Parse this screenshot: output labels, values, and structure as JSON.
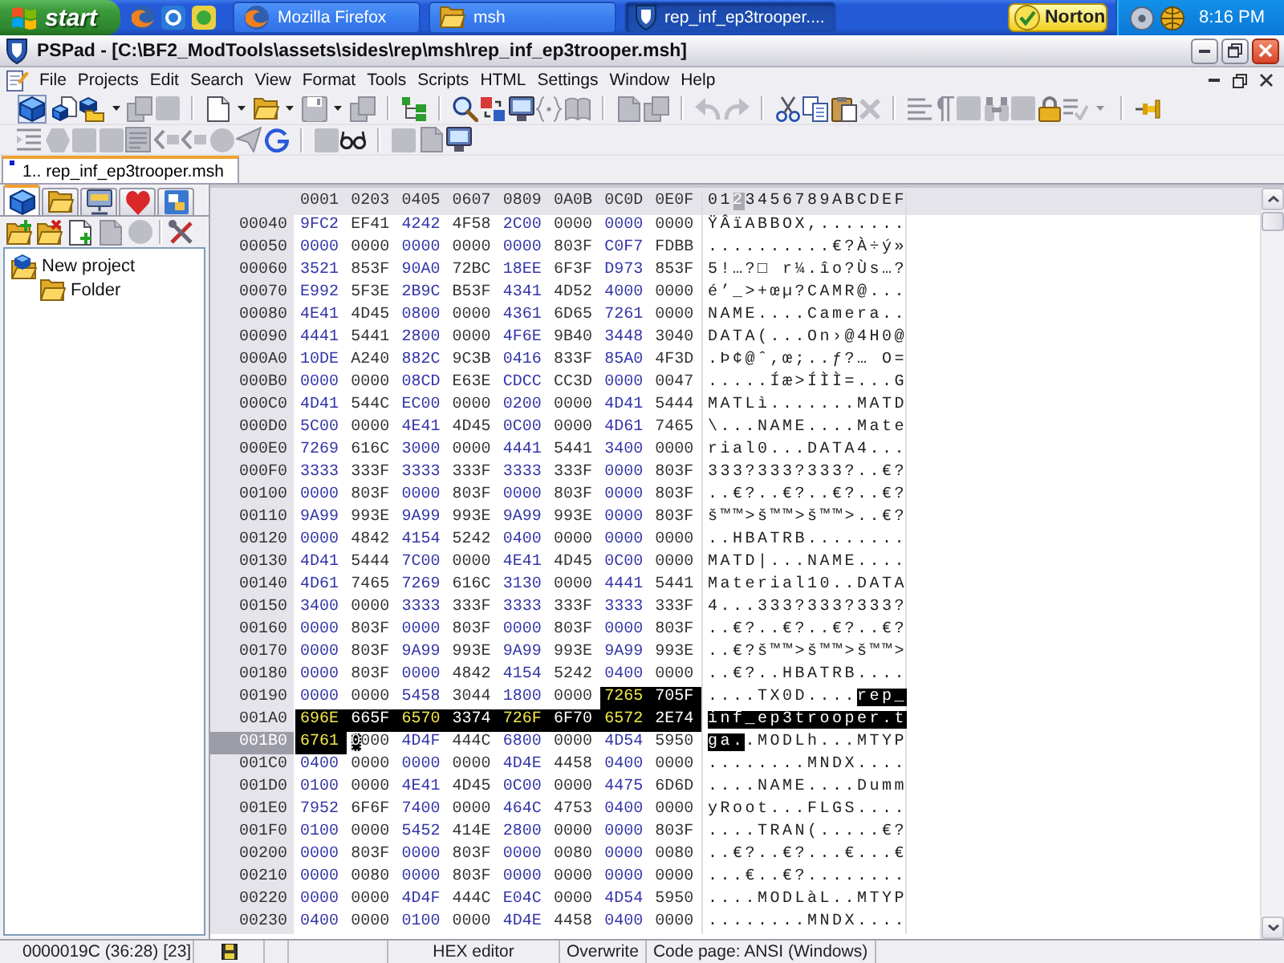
{
  "taskbar": {
    "start": "start",
    "tasks": [
      {
        "label": "Mozilla Firefox",
        "kind": "browser",
        "selected": false
      },
      {
        "label": "msh",
        "kind": "folder",
        "selected": false
      },
      {
        "label": "rep_inf_ep3trooper....",
        "kind": "editor",
        "selected": true
      }
    ],
    "norton": "Norton",
    "clock": "8:16 PM"
  },
  "window": {
    "title": "PSPad - [C:\\BF2_ModTools\\assets\\sides\\rep\\msh\\rep_inf_ep3trooper.msh]"
  },
  "menu": [
    "File",
    "Projects",
    "Edit",
    "Search",
    "View",
    "Format",
    "Tools",
    "Scripts",
    "HTML",
    "Settings",
    "Window",
    "Help"
  ],
  "toolbars": [
    [
      [
        {
          "kind": "cube",
          "disabled": false,
          "pressed": true
        },
        {
          "kind": "cubes",
          "disabled": false,
          "pressed": false
        },
        {
          "kind": "cube-folder",
          "disabled": false,
          "pressed": false
        },
        {
          "kind": "caret",
          "disabled": false,
          "pressed": false
        },
        {
          "kind": "pages",
          "disabled": true,
          "pressed": false
        },
        {
          "kind": "square",
          "disabled": true,
          "pressed": false
        }
      ],
      [
        {
          "kind": "page",
          "disabled": false,
          "pressed": false
        },
        {
          "kind": "caret",
          "disabled": false,
          "pressed": false
        },
        {
          "kind": "folder",
          "disabled": false,
          "pressed": false
        },
        {
          "kind": "caret",
          "disabled": false,
          "pressed": false
        },
        {
          "kind": "floppy",
          "disabled": true,
          "pressed": false
        },
        {
          "kind": "caret",
          "disabled": false,
          "pressed": false
        },
        {
          "kind": "pages",
          "disabled": true,
          "pressed": false
        }
      ],
      [
        {
          "kind": "tree",
          "disabled": false,
          "pressed": false
        }
      ],
      [
        {
          "kind": "search",
          "disabled": false,
          "pressed": false
        },
        {
          "kind": "replace",
          "disabled": false,
          "pressed": false
        },
        {
          "kind": "monitor",
          "disabled": false,
          "pressed": false
        },
        {
          "kind": "braces",
          "disabled": true,
          "pressed": false
        },
        {
          "kind": "book",
          "disabled": true,
          "pressed": false
        }
      ],
      [
        {
          "kind": "page",
          "disabled": true,
          "pressed": false
        },
        {
          "kind": "pages",
          "disabled": true,
          "pressed": false
        }
      ],
      [
        {
          "kind": "undo",
          "disabled": true,
          "pressed": false
        },
        {
          "kind": "redo",
          "disabled": true,
          "pressed": false
        }
      ],
      [
        {
          "kind": "scissors",
          "disabled": false,
          "pressed": false
        },
        {
          "kind": "copy",
          "disabled": false,
          "pressed": false
        },
        {
          "kind": "paste",
          "disabled": false,
          "pressed": false
        },
        {
          "kind": "delete",
          "disabled": true,
          "pressed": false
        }
      ],
      [
        {
          "kind": "lines",
          "disabled": true,
          "pressed": false
        },
        {
          "kind": "pilcrow",
          "disabled": true,
          "pressed": false
        },
        {
          "kind": "square",
          "disabled": true,
          "pressed": false
        },
        {
          "kind": "binoculars",
          "disabled": true,
          "pressed": false
        },
        {
          "kind": "square",
          "disabled": true,
          "pressed": false
        },
        {
          "kind": "lock",
          "disabled": false,
          "pressed": false
        },
        {
          "kind": "spell",
          "disabled": true,
          "pressed": false
        },
        {
          "kind": "caret",
          "disabled": true,
          "pressed": false
        }
      ],
      [
        {
          "kind": "pin",
          "disabled": false,
          "pressed": false
        }
      ]
    ],
    [
      [
        {
          "kind": "indent",
          "disabled": true,
          "pressed": false
        },
        {
          "kind": "hexagon",
          "disabled": true,
          "pressed": false
        },
        {
          "kind": "square",
          "disabled": true,
          "pressed": false
        },
        {
          "kind": "square",
          "disabled": true,
          "pressed": false
        },
        {
          "kind": "text-doc",
          "disabled": true,
          "pressed": false
        },
        {
          "kind": "tag",
          "disabled": true,
          "pressed": false
        },
        {
          "kind": "tag",
          "disabled": true,
          "pressed": false
        },
        {
          "kind": "circle",
          "disabled": true,
          "pressed": false
        },
        {
          "kind": "plane",
          "disabled": true,
          "pressed": false
        },
        {
          "kind": "g",
          "disabled": false,
          "pressed": false
        }
      ],
      [
        {
          "kind": "square",
          "disabled": true,
          "pressed": false
        },
        {
          "kind": "glasses",
          "disabled": false,
          "pressed": false
        }
      ],
      [
        {
          "kind": "square",
          "disabled": true,
          "pressed": false
        },
        {
          "kind": "page",
          "disabled": true,
          "pressed": false
        },
        {
          "kind": "monitor",
          "disabled": false,
          "pressed": false
        }
      ]
    ]
  ],
  "editor_tabs": [
    {
      "label": "1.. rep_inf_ep3trooper.msh",
      "selected": true,
      "modified": true
    }
  ],
  "project_panel": {
    "tabs": [
      {
        "kind": "project",
        "selected": true
      },
      {
        "kind": "folder",
        "selected": false
      },
      {
        "kind": "ftp",
        "selected": false
      },
      {
        "kind": "favorites",
        "selected": false
      },
      {
        "kind": "clips",
        "selected": false
      }
    ],
    "tools": [
      [
        {
          "kind": "folder-add",
          "disabled": false
        },
        {
          "kind": "folder-remove",
          "disabled": false
        },
        {
          "kind": "page-add",
          "disabled": false
        },
        {
          "kind": "page-remove",
          "disabled": true
        },
        {
          "kind": "circle",
          "disabled": true
        }
      ],
      [
        {
          "kind": "tools",
          "disabled": false
        }
      ]
    ],
    "tree": [
      {
        "label": "New project",
        "kind": "project",
        "children": [
          {
            "label": "Folder",
            "kind": "folder"
          }
        ]
      }
    ]
  },
  "hex_view": {
    "columns": [
      "0001",
      "0203",
      "0405",
      "0607",
      "0809",
      "0A0B",
      "0C0D",
      "0E0F"
    ],
    "ascii_header": [
      {
        "text": "01",
        "selected": false
      },
      {
        "text": "2",
        "selected": true
      },
      {
        "text": "3456789ABCDEF",
        "selected": false
      }
    ],
    "rows": [
      {
        "address": "00040",
        "selected": false,
        "hex": [
          "9FC2",
          "EF41",
          "4242",
          "4F58",
          "2C00",
          "0000",
          "0000",
          "0000"
        ],
        "ascii": [
          {
            "text": "ŸÂïABBOX,.......",
            "selected": false,
            "cursor": false
          }
        ]
      },
      {
        "address": "00050",
        "selected": false,
        "hex": [
          "0000",
          "0000",
          "0000",
          "0000",
          "0000",
          "803F",
          "C0F7",
          "FDBB"
        ],
        "ascii": [
          {
            "text": "..........€?À÷ý»",
            "selected": false,
            "cursor": false
          }
        ]
      },
      {
        "address": "00060",
        "selected": false,
        "hex": [
          "3521",
          "853F",
          "90A0",
          "72BC",
          "18EE",
          "6F3F",
          "D973",
          "853F"
        ],
        "ascii": [
          {
            "text": "5!…?□ r¼.îo?Ùs…?",
            "selected": false,
            "cursor": false
          }
        ]
      },
      {
        "address": "00070",
        "selected": false,
        "hex": [
          "E992",
          "5F3E",
          "2B9C",
          "B53F",
          "4341",
          "4D52",
          "4000",
          "0000"
        ],
        "ascii": [
          {
            "text": "é’_>+œµ?CAMR@...",
            "selected": false,
            "cursor": false
          }
        ]
      },
      {
        "address": "00080",
        "selected": false,
        "hex": [
          "4E41",
          "4D45",
          "0800",
          "0000",
          "4361",
          "6D65",
          "7261",
          "0000"
        ],
        "ascii": [
          {
            "text": "NAME....Camera..",
            "selected": false,
            "cursor": false
          }
        ]
      },
      {
        "address": "00090",
        "selected": false,
        "hex": [
          "4441",
          "5441",
          "2800",
          "0000",
          "4F6E",
          "9B40",
          "3448",
          "3040"
        ],
        "ascii": [
          {
            "text": "DATA(...On›@4H0@",
            "selected": false,
            "cursor": false
          }
        ]
      },
      {
        "address": "000A0",
        "selected": false,
        "hex": [
          "10DE",
          "A240",
          "882C",
          "9C3B",
          "0416",
          "833F",
          "85A0",
          "4F3D"
        ],
        "ascii": [
          {
            "text": ".Þ¢@ˆ,œ;..ƒ?… O=",
            "selected": false,
            "cursor": false
          }
        ]
      },
      {
        "address": "000B0",
        "selected": false,
        "hex": [
          "0000",
          "0000",
          "08CD",
          "E63E",
          "CDCC",
          "CC3D",
          "0000",
          "0047"
        ],
        "ascii": [
          {
            "text": ".....Íæ>ÍÌÌ=...G",
            "selected": false,
            "cursor": false
          }
        ]
      },
      {
        "address": "000C0",
        "selected": false,
        "hex": [
          "4D41",
          "544C",
          "EC00",
          "0000",
          "0200",
          "0000",
          "4D41",
          "5444"
        ],
        "ascii": [
          {
            "text": "MATLì.......MATD",
            "selected": false,
            "cursor": false
          }
        ]
      },
      {
        "address": "000D0",
        "selected": false,
        "hex": [
          "5C00",
          "0000",
          "4E41",
          "4D45",
          "0C00",
          "0000",
          "4D61",
          "7465"
        ],
        "ascii": [
          {
            "text": "\\...NAME....Mate",
            "selected": false,
            "cursor": false
          }
        ]
      },
      {
        "address": "000E0",
        "selected": false,
        "hex": [
          "7269",
          "616C",
          "3000",
          "0000",
          "4441",
          "5441",
          "3400",
          "0000"
        ],
        "ascii": [
          {
            "text": "rial0...DATA4...",
            "selected": false,
            "cursor": false
          }
        ]
      },
      {
        "address": "000F0",
        "selected": false,
        "hex": [
          "3333",
          "333F",
          "3333",
          "333F",
          "3333",
          "333F",
          "0000",
          "803F"
        ],
        "ascii": [
          {
            "text": "333?333?333?..€?",
            "selected": false,
            "cursor": false
          }
        ]
      },
      {
        "address": "00100",
        "selected": false,
        "hex": [
          "0000",
          "803F",
          "0000",
          "803F",
          "0000",
          "803F",
          "0000",
          "803F"
        ],
        "ascii": [
          {
            "text": "..€?..€?..€?..€?",
            "selected": false,
            "cursor": false
          }
        ]
      },
      {
        "address": "00110",
        "selected": false,
        "hex": [
          "9A99",
          "993E",
          "9A99",
          "993E",
          "9A99",
          "993E",
          "0000",
          "803F"
        ],
        "ascii": [
          {
            "text": "š™™>š™™>š™™>..€?",
            "selected": false,
            "cursor": false
          }
        ]
      },
      {
        "address": "00120",
        "selected": false,
        "hex": [
          "0000",
          "4842",
          "4154",
          "5242",
          "0400",
          "0000",
          "0000",
          "0000"
        ],
        "ascii": [
          {
            "text": "..HBATRB........",
            "selected": false,
            "cursor": false
          }
        ]
      },
      {
        "address": "00130",
        "selected": false,
        "hex": [
          "4D41",
          "5444",
          "7C00",
          "0000",
          "4E41",
          "4D45",
          "0C00",
          "0000"
        ],
        "ascii": [
          {
            "text": "MATD|...NAME....",
            "selected": false,
            "cursor": false
          }
        ]
      },
      {
        "address": "00140",
        "selected": false,
        "hex": [
          "4D61",
          "7465",
          "7269",
          "616C",
          "3130",
          "0000",
          "4441",
          "5441"
        ],
        "ascii": [
          {
            "text": "Material10..DATA",
            "selected": false,
            "cursor": false
          }
        ]
      },
      {
        "address": "00150",
        "selected": false,
        "hex": [
          "3400",
          "0000",
          "3333",
          "333F",
          "3333",
          "333F",
          "3333",
          "333F"
        ],
        "ascii": [
          {
            "text": "4...333?333?333?",
            "selected": false,
            "cursor": false
          }
        ]
      },
      {
        "address": "00160",
        "selected": false,
        "hex": [
          "0000",
          "803F",
          "0000",
          "803F",
          "0000",
          "803F",
          "0000",
          "803F"
        ],
        "ascii": [
          {
            "text": "..€?..€?..€?..€?",
            "selected": false,
            "cursor": false
          }
        ]
      },
      {
        "address": "00170",
        "selected": false,
        "hex": [
          "0000",
          "803F",
          "9A99",
          "993E",
          "9A99",
          "993E",
          "9A99",
          "993E"
        ],
        "ascii": [
          {
            "text": "..€?š™™>š™™>š™™>",
            "selected": false,
            "cursor": false
          }
        ]
      },
      {
        "address": "00180",
        "selected": false,
        "hex": [
          "0000",
          "803F",
          "0000",
          "4842",
          "4154",
          "5242",
          "0400",
          "0000"
        ],
        "ascii": [
          {
            "text": "..€?..HBATRB....",
            "selected": false,
            "cursor": false
          }
        ]
      },
      {
        "address": "00190",
        "selected": false,
        "hex": [
          "0000",
          "0000",
          "5458",
          "3044",
          "1800",
          "0000",
          "7265",
          "705F"
        ],
        "ascii": [
          {
            "text": "....TX0D....",
            "selected": false,
            "cursor": false
          },
          {
            "text": "rep_",
            "selected": true,
            "cursor": false
          }
        ]
      },
      {
        "address": "001A0",
        "selected": false,
        "hex": [
          "696E",
          "665F",
          "6570",
          "3374",
          "726F",
          "6F70",
          "6572",
          "2E74"
        ],
        "ascii": [
          {
            "text": "inf_ep3trooper.t",
            "selected": true,
            "cursor": false
          }
        ]
      },
      {
        "address": "001B0",
        "selected": true,
        "hex": [
          "6761",
          "0000",
          "4D4F",
          "444C",
          "6800",
          "0000",
          "4D54",
          "5950"
        ],
        "ascii": [
          {
            "text": "ga",
            "selected": true,
            "cursor": false
          },
          {
            "text": ".",
            "selected": false,
            "cursor": true
          },
          {
            "text": ".MODLh...MTYP",
            "selected": false,
            "cursor": false
          }
        ]
      },
      {
        "address": "001C0",
        "selected": false,
        "hex": [
          "0400",
          "0000",
          "0000",
          "0000",
          "4D4E",
          "4458",
          "0400",
          "0000"
        ],
        "ascii": [
          {
            "text": "........MNDX....",
            "selected": false,
            "cursor": false
          }
        ]
      },
      {
        "address": "001D0",
        "selected": false,
        "hex": [
          "0100",
          "0000",
          "4E41",
          "4D45",
          "0C00",
          "0000",
          "4475",
          "6D6D"
        ],
        "ascii": [
          {
            "text": "....NAME....Dumm",
            "selected": false,
            "cursor": false
          }
        ]
      },
      {
        "address": "001E0",
        "selected": false,
        "hex": [
          "7952",
          "6F6F",
          "7400",
          "0000",
          "464C",
          "4753",
          "0400",
          "0000"
        ],
        "ascii": [
          {
            "text": "yRoot...FLGS....",
            "selected": false,
            "cursor": false
          }
        ]
      },
      {
        "address": "001F0",
        "selected": false,
        "hex": [
          "0100",
          "0000",
          "5452",
          "414E",
          "2800",
          "0000",
          "0000",
          "803F"
        ],
        "ascii": [
          {
            "text": "....TRAN(.....€?",
            "selected": false,
            "cursor": false
          }
        ]
      },
      {
        "address": "00200",
        "selected": false,
        "hex": [
          "0000",
          "803F",
          "0000",
          "803F",
          "0000",
          "0080",
          "0000",
          "0080"
        ],
        "ascii": [
          {
            "text": "..€?..€?...€...€",
            "selected": false,
            "cursor": false
          }
        ]
      },
      {
        "address": "00210",
        "selected": false,
        "hex": [
          "0000",
          "0080",
          "0000",
          "803F",
          "0000",
          "0000",
          "0000",
          "0000"
        ],
        "ascii": [
          {
            "text": "...€..€?........",
            "selected": false,
            "cursor": false
          }
        ]
      },
      {
        "address": "00220",
        "selected": false,
        "hex": [
          "0000",
          "0000",
          "4D4F",
          "444C",
          "E04C",
          "0000",
          "4D54",
          "5950"
        ],
        "ascii": [
          {
            "text": "....MODLàL..MTYP",
            "selected": false,
            "cursor": false
          }
        ]
      },
      {
        "address": "00230",
        "selected": false,
        "hex": [
          "0400",
          "0000",
          "0100",
          "0000",
          "4D4E",
          "4458",
          "0400",
          "0000"
        ],
        "ascii": [
          {
            "text": "........MNDX....",
            "selected": false,
            "cursor": false
          }
        ]
      }
    ]
  },
  "status_bar": {
    "position": "0000019C (36:28) [23]",
    "modified": true,
    "mode": "HEX editor",
    "insert_mode": "Overwrite",
    "code_page": "Code page: ANSI (Windows)"
  }
}
